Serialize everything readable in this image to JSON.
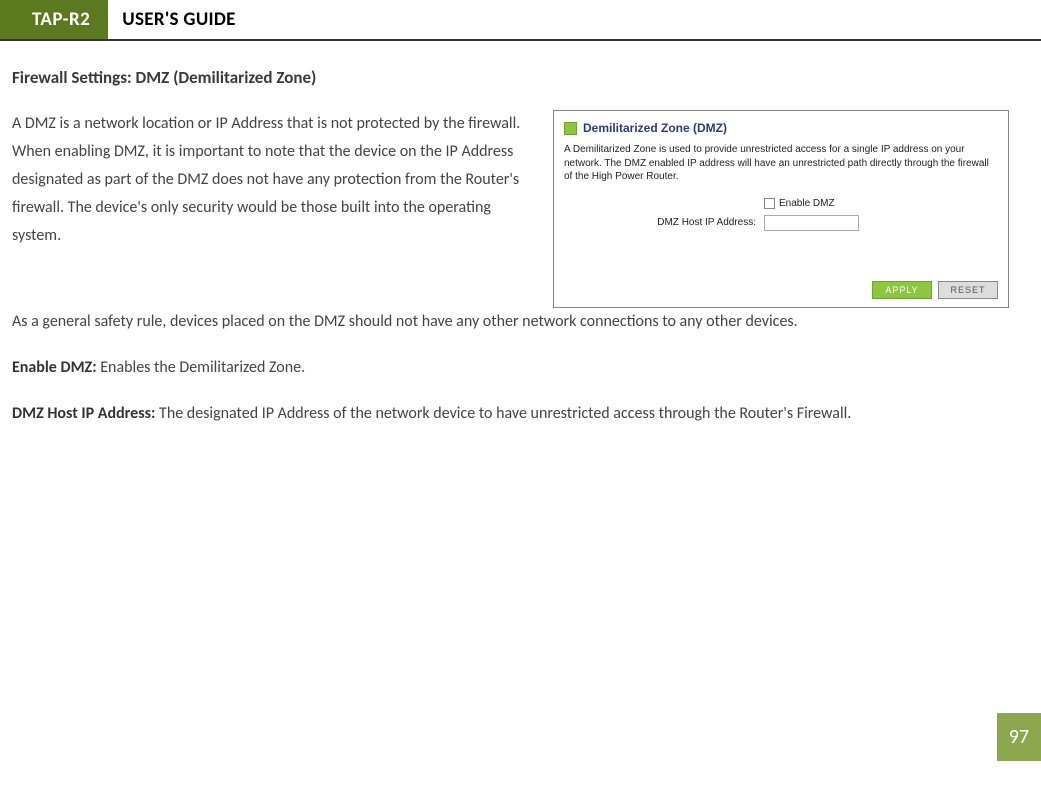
{
  "header": {
    "model": "TAP-R2",
    "title": "USER'S GUIDE"
  },
  "section_heading": "Firewall Settings: DMZ (Demilitarized Zone)",
  "para1": "A DMZ is a network location or IP Address that is not protected by the firewall.  When enabling DMZ, it is important to note that the device on the IP Address designated as part of the DMZ does not have any protection from the Router's firewall.  The device's only security would be those built into the operating system.",
  "para2": "As a general safety rule, devices placed on the DMZ should not have any other network connections to any other devices.",
  "para3_bold": "Enable DMZ:",
  "para3_rest": " Enables the Demilitarized Zone.",
  "para4_bold": "DMZ Host IP Address:",
  "para4_rest": " The designated IP Address of the network device to have unrestricted access through the Router's Firewall.",
  "panel": {
    "title": "Demilitarized Zone (DMZ)",
    "desc": "A Demilitarized Zone is used to provide unrestricted access for a single IP address on your network. The DMZ enabled IP address will have an unrestricted path directly through the firewall of the High Power Router.",
    "enable_label": "Enable DMZ",
    "host_label": "DMZ Host IP Address:",
    "apply": "APPLY",
    "reset": "RESET"
  },
  "page_number": "97"
}
